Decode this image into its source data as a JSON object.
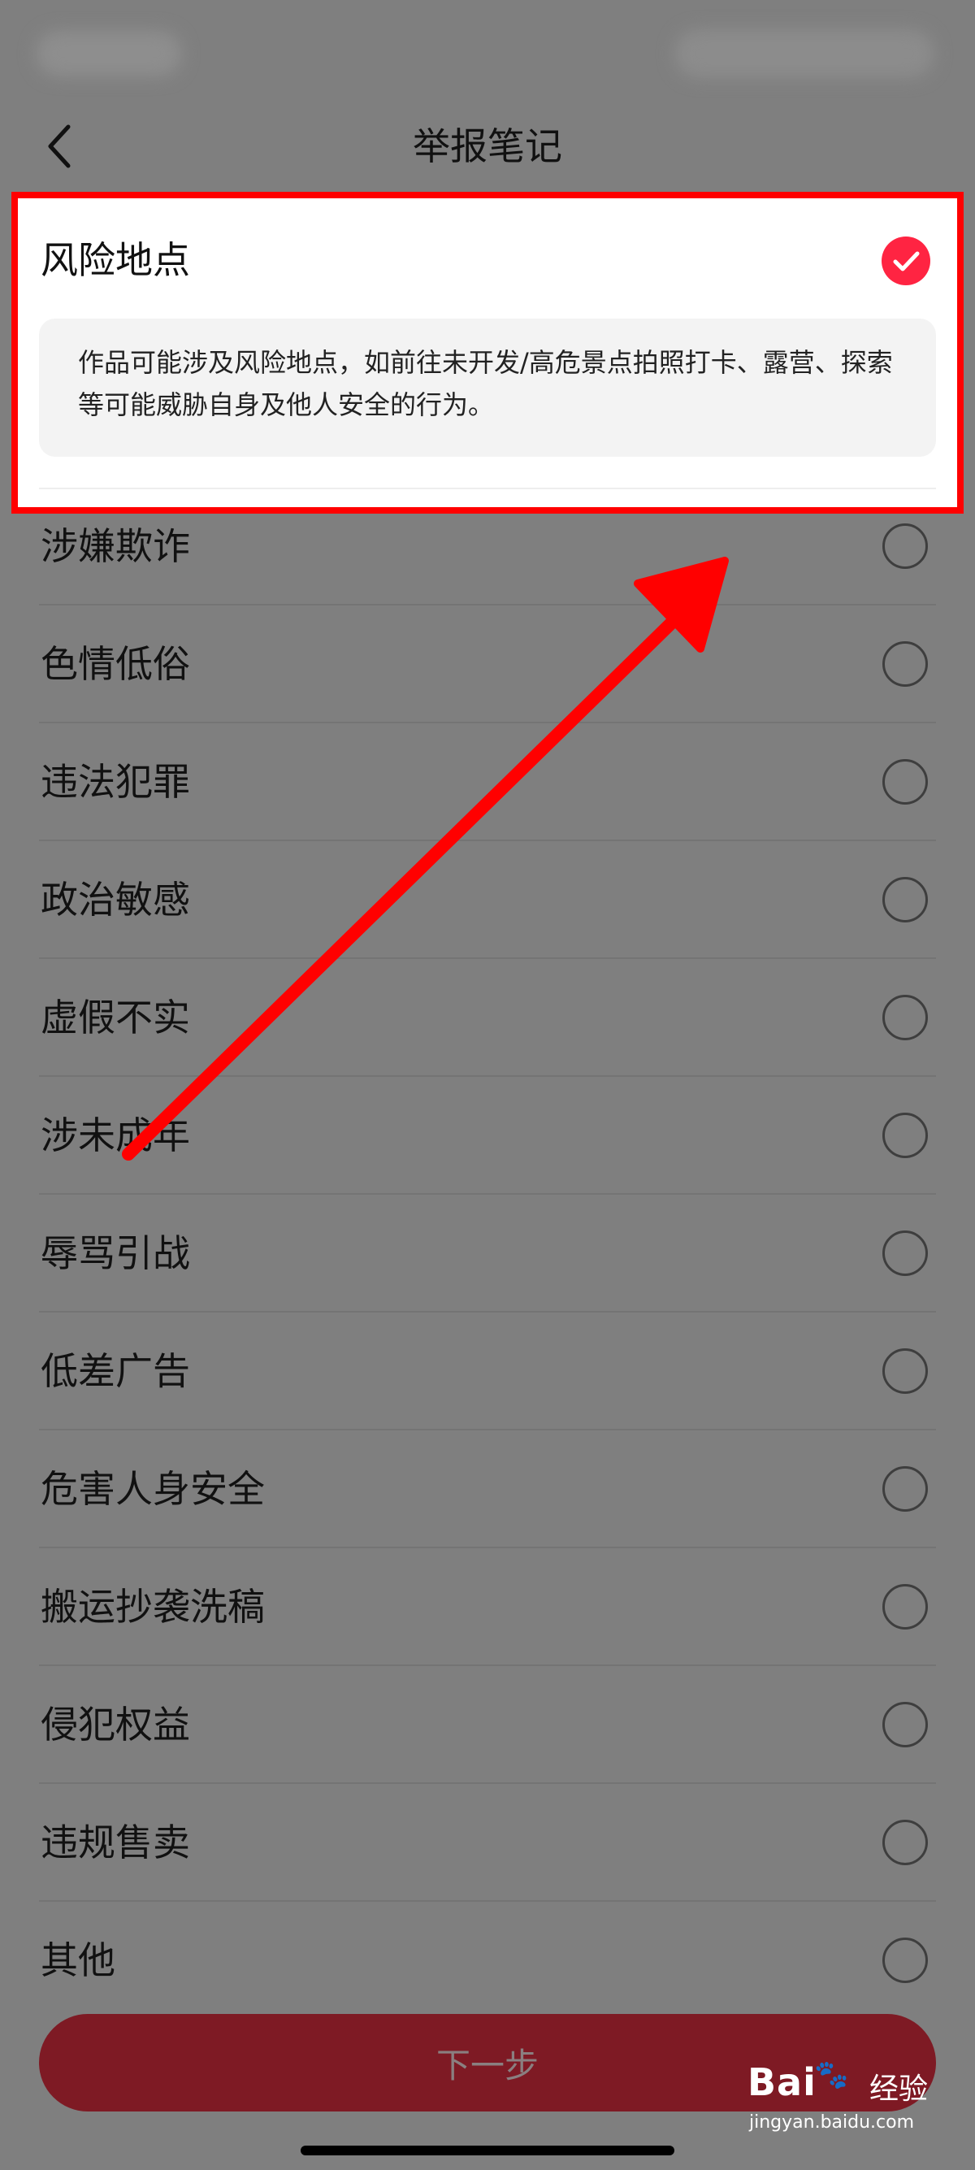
{
  "header": {
    "title": "举报笔记"
  },
  "selected": {
    "label": "风险地点",
    "description": "作品可能涉及风险地点，如前往未开发/高危景点拍照打卡、露营、探索等可能威胁自身及他人安全的行为。"
  },
  "options": [
    "涉嫌欺诈",
    "色情低俗",
    "违法犯罪",
    "政治敏感",
    "虚假不实",
    "涉未成年",
    "辱骂引战",
    "低差广告",
    "危害人身安全",
    "搬运抄袭洗稿",
    "侵犯权益",
    "违规售卖",
    "其他"
  ],
  "next_button": "下一步",
  "watermark": {
    "logo": "Bai",
    "suffix": "经验",
    "url": "jingyan.baidu.com"
  },
  "colors": {
    "accent": "#ff2442",
    "annotation": "#ff0000"
  }
}
